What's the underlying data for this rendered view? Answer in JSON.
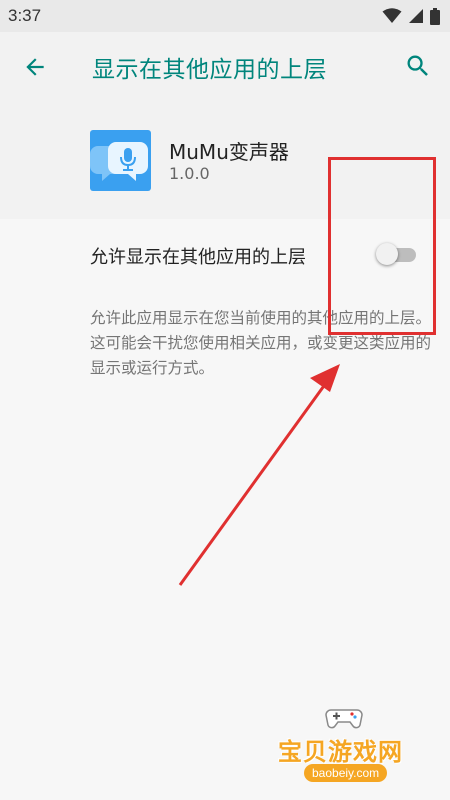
{
  "statusbar": {
    "time": "3:37"
  },
  "appbar": {
    "title": "显示在其他应用的上层"
  },
  "app": {
    "name": "MuMu变声器",
    "version": "1.0.0"
  },
  "setting": {
    "label": "允许显示在其他应用的上层",
    "enabled": false,
    "description": "允许此应用显示在您当前使用的其他应用的上层。这可能会干扰您使用相关应用，或变更这类应用的显示或运行方式。"
  },
  "watermark": {
    "text": "宝贝游戏网",
    "url": "baobeiy.com"
  },
  "colors": {
    "accent": "#00857c",
    "annotation": "#e03030",
    "watermark": "#f5a623"
  },
  "icons": [
    "wifi-icon",
    "signal-icon",
    "battery-icon",
    "back-arrow-icon",
    "search-icon",
    "app-icon",
    "gamepad-icon"
  ]
}
